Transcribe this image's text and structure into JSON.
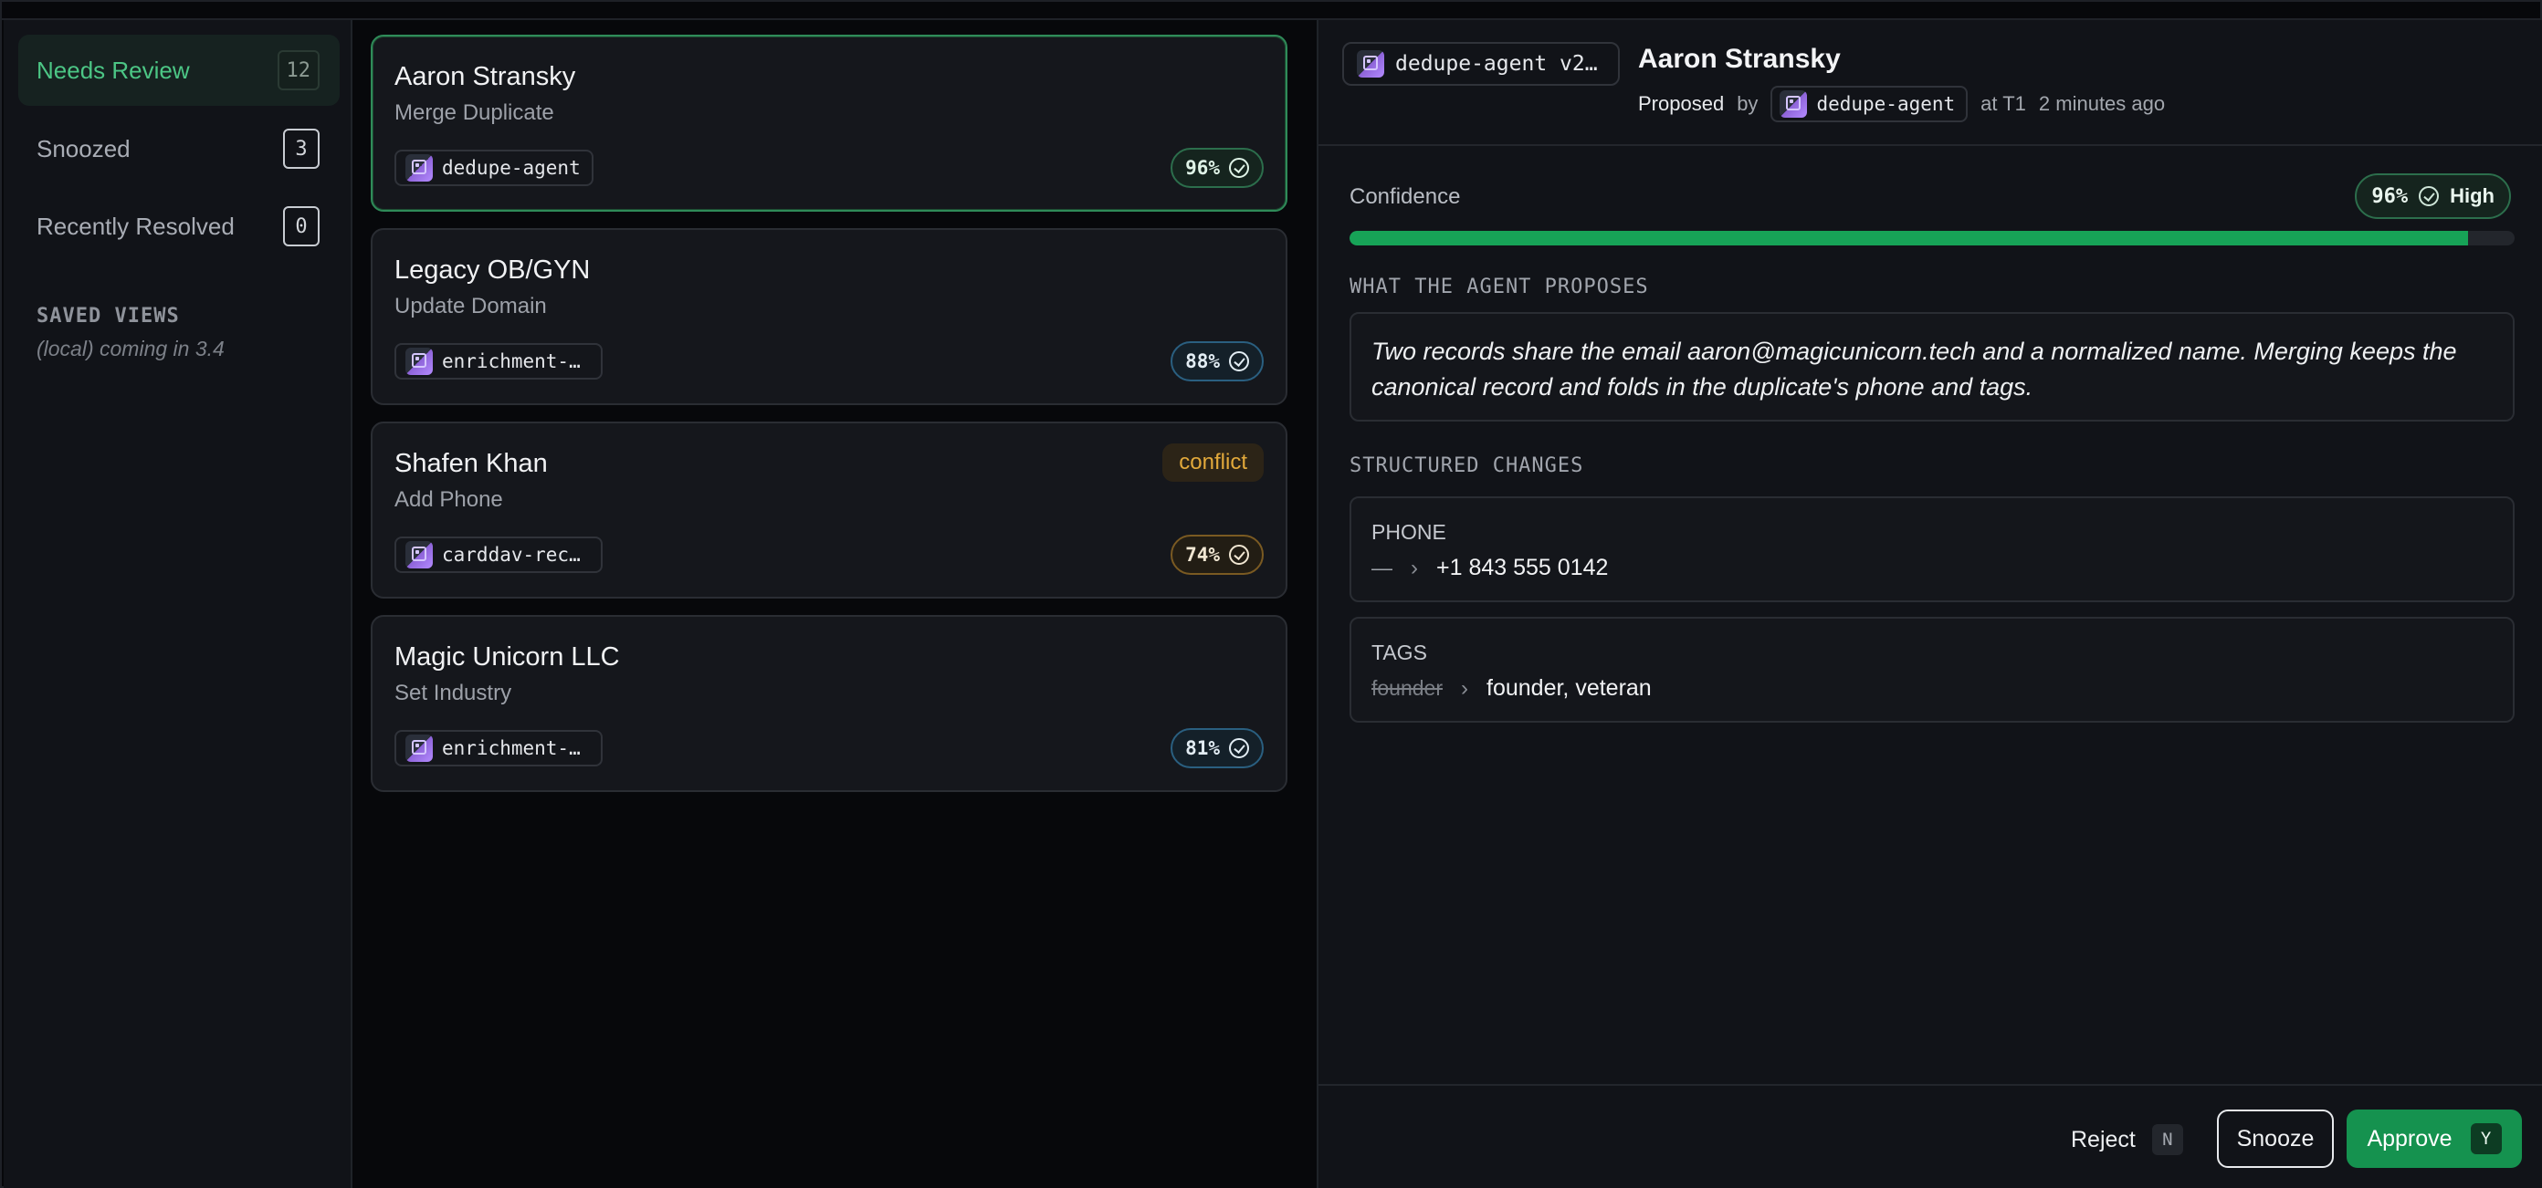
{
  "sidebar": {
    "items": [
      {
        "label": "Needs Review",
        "count": "12"
      },
      {
        "label": "Snoozed",
        "count": "3"
      },
      {
        "label": "Recently Resolved",
        "count": "0"
      }
    ],
    "saved_views_title": "SAVED VIEWS",
    "saved_views_sub": "(local) coming in 3.4"
  },
  "list": {
    "cards": [
      {
        "name": "Aaron Stransky",
        "action": "Merge Duplicate",
        "agent": "dedupe-agent",
        "confidence": "96%",
        "selected": true
      },
      {
        "name": "Legacy OB/GYN",
        "action": "Update Domain",
        "agent": "enrichment-a…",
        "confidence": "88%"
      },
      {
        "name": "Shafen Khan",
        "action": "Add Phone",
        "agent": "carddav-reco…",
        "confidence": "74%",
        "badge": "conflict"
      },
      {
        "name": "Magic Unicorn LLC",
        "action": "Set Industry",
        "agent": "enrichment-a…",
        "confidence": "81%"
      }
    ]
  },
  "detail": {
    "version_chip": "dedupe-agent v2…",
    "title": "Aaron Stransky",
    "proposed": "Proposed",
    "by": "by",
    "by_agent": "dedupe-agent",
    "at": "at T1",
    "time": "2 minutes ago",
    "confidence_label": "Confidence",
    "confidence_value": "96%",
    "confidence_fraction": 0.96,
    "confidence_level": "High",
    "proposes_heading": "WHAT THE AGENT PROPOSES",
    "proposes_text": "Two records share the email aaron@magicunicorn.tech and a normalized name. Merging keeps the canonical record and folds in the duplicate's phone and tags.",
    "changes_heading": "STRUCTURED CHANGES",
    "changes": [
      {
        "field": "PHONE",
        "old": "—",
        "new": "+1 843 555 0142"
      },
      {
        "field": "TAGS",
        "old": "founder",
        "new": "founder, veteran"
      }
    ],
    "footer": {
      "reject": "Reject",
      "reject_key": "N",
      "snooze": "Snooze",
      "approve": "Approve",
      "approve_key": "Y"
    }
  },
  "colors": {
    "accent_green": "#15924f",
    "progress_green": "#17a357",
    "conflict_amber": "#e2a93b"
  },
  "icons": {
    "agent": "agent-chip-icon",
    "check": "check-circle-icon",
    "arrow": "chevron-right-icon"
  }
}
